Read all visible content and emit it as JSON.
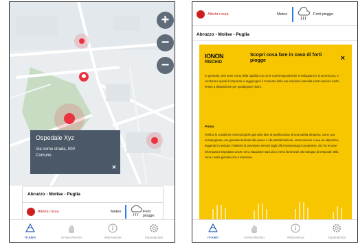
{
  "left": {
    "popup": {
      "title": "Ospedale Xyz",
      "address": "Via nome strada, 000",
      "city": "Comune",
      "close": "×"
    },
    "map_controls": {
      "zoom_in": "+",
      "zoom_out_1": "−",
      "zoom_out_2": "−"
    },
    "card": {
      "region": "Abruzzo - Molise - Puglia",
      "alert_label": "Allerta rossa",
      "meteo_label": "Meteo",
      "forecast_label": "Forti piogge",
      "alert_color": "#cc1f1f",
      "accent_color": "#2b7de0"
    }
  },
  "right": {
    "topbar": {
      "alert_label": "Allerta rossa",
      "meteo_label": "Meteo",
      "forecast_label": "Forti piogge"
    },
    "region": "Abruzzo - Molise - Puglia",
    "panel": {
      "logo_main": "IONON",
      "logo_sub": "RISCHIO",
      "title": "Scopri cosa fare in caso di forti piogge",
      "close": "×",
      "intro": "In generale, devi tener conto della rapidità con cui le nubi temporalesche si sviluppano e si accrescono, e condurono quindi il temporale a raggiungere il momento della sua massima intensità senza lasciare molto tempo a disposizione per guadagnare riparo.",
      "section_title": "Prima",
      "section_text": "Verifica le condizioni meteorologiche già nella fase di pianificazione di una attività all'aperto, come una scampagnata, una giornata dedicata alla pesca o alle attività balneari, un'escursione o una via alpinistica, leggendo in anticipo i bollettini di previsione emessi dagli uffici meteorologici competenti, che fra le tante informazioni segnalano anche se la situazione sarà più o meno favorevole allo sviluppo di temporali nella zona o nella giornata che ti interessa.",
      "background_color": "#f7c600"
    }
  },
  "tabbar": {
    "tabs": [
      {
        "label": "IT-Alert",
        "icon": "alert-icon",
        "active": true
      },
      {
        "label": "Io Non Rischio",
        "icon": "hand-icon",
        "active": false
      },
      {
        "label": "Informazioni",
        "icon": "info-icon",
        "active": false
      },
      {
        "label": "Impostazioni",
        "icon": "gear-icon",
        "active": false
      }
    ],
    "active_color": "#2b5fb4"
  }
}
